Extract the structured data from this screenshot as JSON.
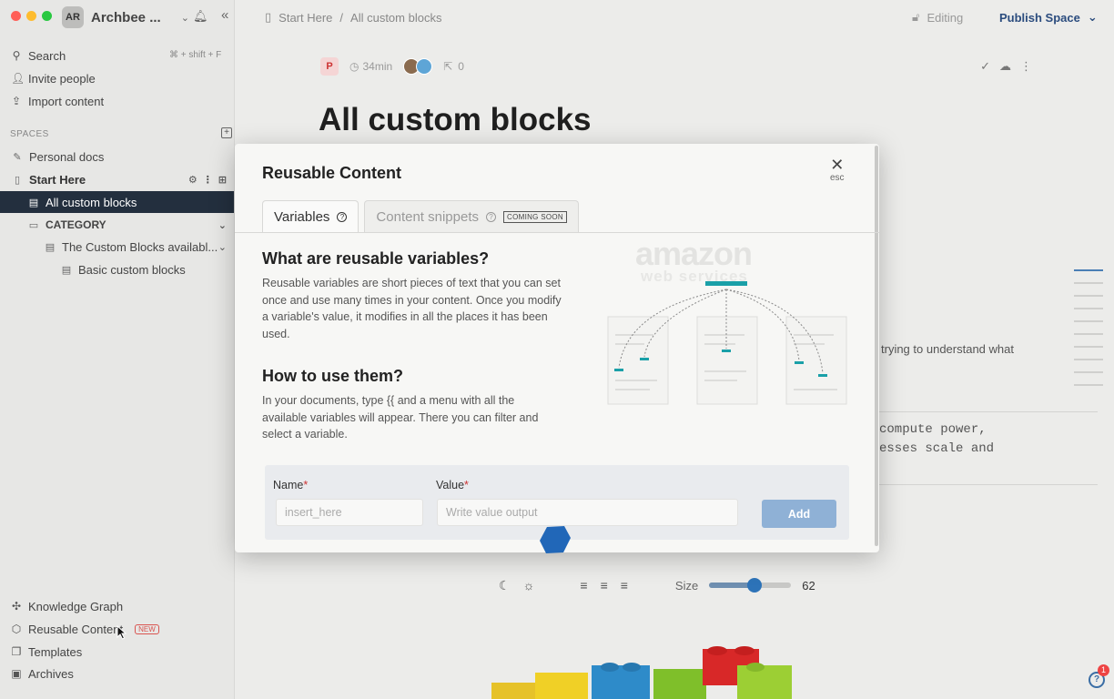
{
  "workspace": {
    "avatar": "AR",
    "name": "Archbee ..."
  },
  "sidebar": {
    "search": {
      "label": "Search",
      "shortcut": "⌘ + shift + F"
    },
    "invite": "Invite people",
    "import": "Import content",
    "spaces_label": "SPACES",
    "tree": [
      {
        "label": "Personal docs"
      },
      {
        "label": "Start Here"
      },
      {
        "label": "All custom blocks"
      },
      {
        "label": "CATEGORY"
      },
      {
        "label": "The Custom Blocks availabl..."
      },
      {
        "label": "Basic custom blocks"
      }
    ],
    "bottom": {
      "graph": "Knowledge Graph",
      "reusable": "Reusable Content",
      "reusable_badge": "NEW",
      "templates": "Templates",
      "archives": "Archives"
    }
  },
  "topbar": {
    "breadcrumb_space": "Start Here",
    "breadcrumb_sep": "/",
    "breadcrumb_page": "All custom blocks",
    "editing": "Editing",
    "publish": "Publish Space"
  },
  "meta": {
    "badge": "P",
    "read_time": "34min",
    "mentions": "0"
  },
  "document": {
    "title": "All custom blocks",
    "partial_text": "trying to understand what",
    "code_line1": "compute power,",
    "code_line2": "esses scale and"
  },
  "controls": {
    "size_label": "Size",
    "size_value": "62",
    "size_fraction": 0.55
  },
  "help": {
    "badge": "1"
  },
  "modal": {
    "title": "Reusable Content",
    "close_label": "esc",
    "tabs": [
      {
        "label": "Variables"
      },
      {
        "label": "Content snippets",
        "badge": "COMING SOON"
      }
    ],
    "section1_title": "What are reusable variables?",
    "section1_text": "Reusable variables are short pieces of text that you can set once and use many times in your content. Once you modify a variable's value, it modifies in all the places it has been used.",
    "section2_title": "How to use them?",
    "section2_text": "In your documents, type {{ and a menu with all the available variables will appear. There you can filter and select a variable.",
    "illustration": {
      "logo_main": "amazon",
      "logo_sub": "web services"
    },
    "form": {
      "name_label": "Name",
      "name_placeholder": "insert_here",
      "value_label": "Value",
      "value_placeholder": "Write value output",
      "required_mark": "*",
      "add_label": "Add"
    }
  },
  "colors": {
    "active_row": "#232f3e",
    "accent_blue": "#2d73b8",
    "add_button": "#8fb1d6",
    "teal_node": "#1aa0a8"
  }
}
